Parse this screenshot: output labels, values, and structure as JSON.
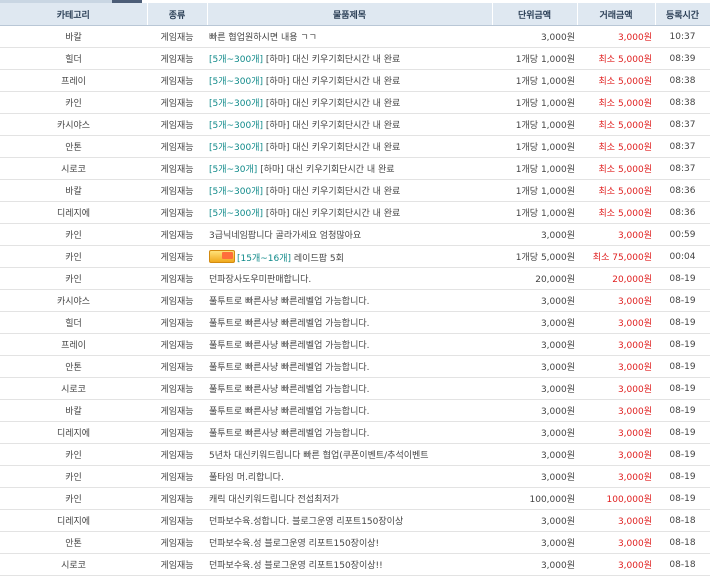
{
  "headers": {
    "category": "카테고리",
    "kind": "종류",
    "title": "물품제목",
    "unit_price": "단위금액",
    "trade_price": "거래금액",
    "time": "등록시간"
  },
  "rows": [
    {
      "category": "바칼",
      "kind": "게임재능",
      "tag": "",
      "title": "빠른 협업원하시면 내용 ㄱㄱ",
      "unit": "3,000원",
      "price": "3,000원",
      "time": "10:37"
    },
    {
      "category": "힐더",
      "kind": "게임재능",
      "tag": "[5개~300개]",
      "title": "[하마] 대신 키우기회단시간 내 완료",
      "unit": "1개당 1,000원",
      "price": "최소 5,000원",
      "time": "08:39"
    },
    {
      "category": "프레이",
      "kind": "게임재능",
      "tag": "[5개~300개]",
      "title": "[하마] 대신 키우기회단시간 내 완료",
      "unit": "1개당 1,000원",
      "price": "최소 5,000원",
      "time": "08:38"
    },
    {
      "category": "카인",
      "kind": "게임재능",
      "tag": "[5개~300개]",
      "title": "[하마] 대신 키우기회단시간 내 완료",
      "unit": "1개당 1,000원",
      "price": "최소 5,000원",
      "time": "08:38"
    },
    {
      "category": "카시야스",
      "kind": "게임재능",
      "tag": "[5개~300개]",
      "title": "[하마] 대신 키우기회단시간 내 완료",
      "unit": "1개당 1,000원",
      "price": "최소 5,000원",
      "time": "08:37"
    },
    {
      "category": "안톤",
      "kind": "게임재능",
      "tag": "[5개~300개]",
      "title": "[하마] 대신 키우기회단시간 내 완료",
      "unit": "1개당 1,000원",
      "price": "최소 5,000원",
      "time": "08:37"
    },
    {
      "category": "시로코",
      "kind": "게임재능",
      "tag": "[5개~30개]",
      "title": "[하마] 대신 키우기회단시간 내 완료",
      "unit": "1개당 1,000원",
      "price": "최소 5,000원",
      "time": "08:37"
    },
    {
      "category": "바칼",
      "kind": "게임재능",
      "tag": "[5개~300개]",
      "title": "[하마] 대신 키우기회단시간 내 완료",
      "unit": "1개당 1,000원",
      "price": "최소 5,000원",
      "time": "08:36"
    },
    {
      "category": "디레지에",
      "kind": "게임재능",
      "tag": "[5개~300개]",
      "title": "[하마] 대신 키우기회단시간 내 완료",
      "unit": "1개당 1,000원",
      "price": "최소 5,000원",
      "time": "08:36"
    },
    {
      "category": "카인",
      "kind": "게임재능",
      "tag": "",
      "title": "3급닉네임팝니다 골라가세요 엄청많아요",
      "unit": "3,000원",
      "price": "3,000원",
      "time": "00:59"
    },
    {
      "category": "카인",
      "kind": "게임재능",
      "cert": "인증",
      "tag": "[15개~16개]",
      "title": "레이드팝 5회",
      "unit": "1개당 5,000원",
      "price": "최소 75,000원",
      "time": "00:04"
    },
    {
      "category": "카인",
      "kind": "게임재능",
      "tag": "",
      "title": "던파장사도우미판매합니다.",
      "unit": "20,000원",
      "price": "20,000원",
      "time": "08-19"
    },
    {
      "category": "카시야스",
      "kind": "게임재능",
      "tag": "",
      "title": "풀투트로 빠른사냥 빠른레벨업 가능합니다.",
      "unit": "3,000원",
      "price": "3,000원",
      "time": "08-19"
    },
    {
      "category": "힐더",
      "kind": "게임재능",
      "tag": "",
      "title": "풀투트로 빠른사냥 빠른레벨업 가능합니다.",
      "unit": "3,000원",
      "price": "3,000원",
      "time": "08-19"
    },
    {
      "category": "프레이",
      "kind": "게임재능",
      "tag": "",
      "title": "풀투트로 빠른사냥 빠른레벨업 가능합니다.",
      "unit": "3,000원",
      "price": "3,000원",
      "time": "08-19"
    },
    {
      "category": "안톤",
      "kind": "게임재능",
      "tag": "",
      "title": "풀투트로 빠른사냥 빠른레벨업 가능합니다.",
      "unit": "3,000원",
      "price": "3,000원",
      "time": "08-19"
    },
    {
      "category": "시로코",
      "kind": "게임재능",
      "tag": "",
      "title": "풀투트로 빠른사냥 빠른레벨업 가능합니다.",
      "unit": "3,000원",
      "price": "3,000원",
      "time": "08-19"
    },
    {
      "category": "바칼",
      "kind": "게임재능",
      "tag": "",
      "title": "풀투트로 빠른사냥 빠른레벨업 가능합니다.",
      "unit": "3,000원",
      "price": "3,000원",
      "time": "08-19"
    },
    {
      "category": "디레지에",
      "kind": "게임재능",
      "tag": "",
      "title": "풀투트로 빠른사냥 빠른레벨업 가능합니다.",
      "unit": "3,000원",
      "price": "3,000원",
      "time": "08-19"
    },
    {
      "category": "카인",
      "kind": "게임재능",
      "tag": "",
      "title": "5년차 대신키워드립니다 빠른 협업(쿠폰이벤트/추석이벤트",
      "unit": "3,000원",
      "price": "3,000원",
      "time": "08-19"
    },
    {
      "category": "카인",
      "kind": "게임재능",
      "tag": "",
      "title": "풀타임 머.리합니다.",
      "unit": "3,000원",
      "price": "3,000원",
      "time": "08-19"
    },
    {
      "category": "카인",
      "kind": "게임재능",
      "tag": "",
      "title": "캐릭 대신키워드립니다 전섭최저가",
      "unit": "100,000원",
      "price": "100,000원",
      "time": "08-19"
    },
    {
      "category": "디레지에",
      "kind": "게임재능",
      "tag": "",
      "title": "던파보수육.성합니다. 블로그운영 리포트150장이상",
      "unit": "3,000원",
      "price": "3,000원",
      "time": "08-18"
    },
    {
      "category": "안톤",
      "kind": "게임재능",
      "tag": "",
      "title": "던파보수육.성 블로그운영 리포트150장이상!",
      "unit": "3,000원",
      "price": "3,000원",
      "time": "08-18"
    },
    {
      "category": "시로코",
      "kind": "게임재능",
      "tag": "",
      "title": "던파보수육.성 블로그운영 리포트150장이상!!",
      "unit": "3,000원",
      "price": "3,000원",
      "time": "08-18"
    }
  ]
}
